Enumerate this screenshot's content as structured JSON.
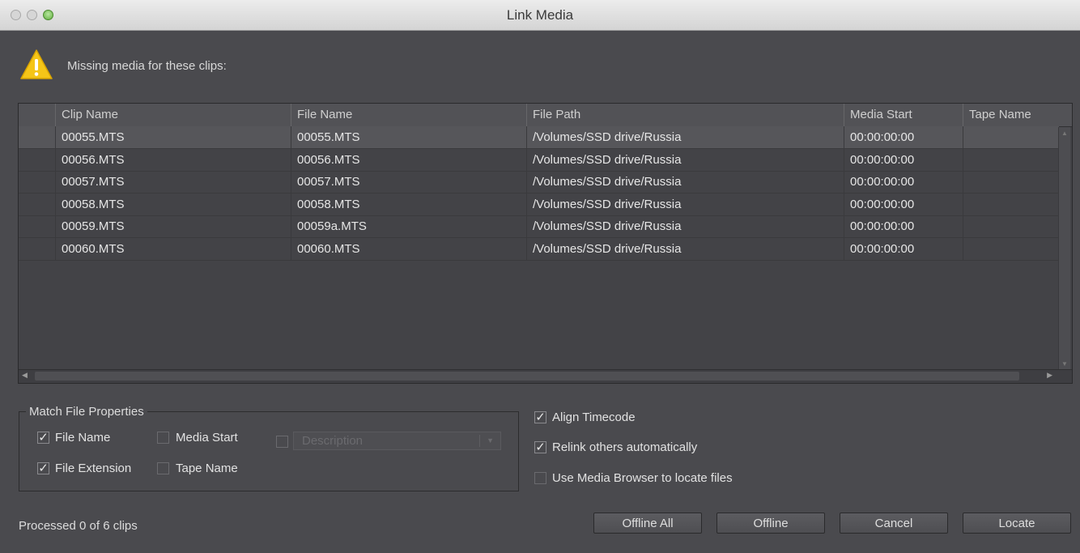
{
  "window": {
    "title": "Link Media"
  },
  "warning": {
    "text": "Missing media for these clips:",
    "icon": "warning-icon"
  },
  "table": {
    "columns": [
      "Clip Name",
      "File Name",
      "File Path",
      "Media Start",
      "Tape Name"
    ],
    "rows": [
      [
        "00055.MTS",
        "00055.MTS",
        "/Volumes/SSD drive/Russia",
        "00:00:00:00",
        ""
      ],
      [
        "00056.MTS",
        "00056.MTS",
        "/Volumes/SSD drive/Russia",
        "00:00:00:00",
        ""
      ],
      [
        "00057.MTS",
        "00057.MTS",
        "/Volumes/SSD drive/Russia",
        "00:00:00:00",
        ""
      ],
      [
        "00058.MTS",
        "00058.MTS",
        "/Volumes/SSD drive/Russia",
        "00:00:00:00",
        ""
      ],
      [
        "00059.MTS",
        "00059a.MTS",
        "/Volumes/SSD drive/Russia",
        "00:00:00:00",
        ""
      ],
      [
        "00060.MTS",
        "00060.MTS",
        "/Volumes/SSD drive/Russia",
        "00:00:00:00",
        ""
      ]
    ],
    "selected_row": 0
  },
  "match_props": {
    "title": "Match File Properties",
    "file_name": {
      "label": "File Name",
      "checked": true
    },
    "media_start": {
      "label": "Media Start",
      "checked": false
    },
    "description": {
      "label": "Description",
      "checked": false
    },
    "file_extension": {
      "label": "File Extension",
      "checked": true
    },
    "tape_name": {
      "label": "Tape Name",
      "checked": false
    }
  },
  "options": {
    "align_timecode": {
      "label": "Align Timecode",
      "checked": true
    },
    "relink_others": {
      "label": "Relink others automatically",
      "checked": true
    },
    "use_media_browser": {
      "label": "Use Media Browser to locate files",
      "checked": false
    }
  },
  "status": "Processed 0 of 6 clips",
  "buttons": {
    "offline_all": "Offline All",
    "offline": "Offline",
    "cancel": "Cancel",
    "locate": "Locate"
  },
  "check_glyph": "✓",
  "colors": {
    "background": "#4a4a4e",
    "warning": "#f5c518",
    "text": "#e2e2e2"
  }
}
